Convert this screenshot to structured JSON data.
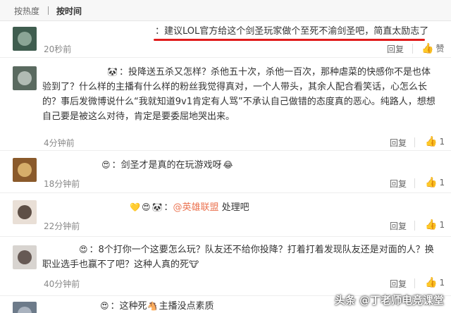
{
  "sort_bar": {
    "hot_label": "按热度",
    "time_label": "按时间"
  },
  "comments": [
    {
      "prefix": "：",
      "text": "建议LOL官方给这个剑圣玩家做个至死不渝剑圣吧，简直太励志了",
      "time": "20秒前",
      "reply_label": "回复",
      "like_label": "赞"
    },
    {
      "prefix": "：",
      "text": "投降送五杀又怎样？杀他五十次，杀他一百次，那种虐菜的快感你不是也体验到了？什么样的主播有什么样的粉丝我觉得真对，一个人带头，其余人配合看笑话，心怎么长的？事后发微博说什么“我就知道9v1肯定有人骂”不承认自己做错的态度真的恶心。纯路人，想想自己要是被这么对待，肯定是要委屈地哭出来。",
      "time": "4分钟前",
      "reply_label": "回复",
      "like_label": "1"
    },
    {
      "prefix": "：",
      "text": "剑圣才是真的在玩游戏呀",
      "time": "18分钟前",
      "reply_label": "回复",
      "like_label": "1"
    },
    {
      "prefix": "：",
      "mention": "@英雄联盟",
      "text": " 处理吧",
      "time": "22分钟前",
      "reply_label": "回复",
      "like_label": "1"
    },
    {
      "prefix": "：",
      "text": "8个打你一个这要怎么玩？队友还不给你投降？打着打着发现队友还是对面的人？换职业选手也赢不了吧？这种人真的死",
      "time": "40分钟前",
      "reply_label": "回复",
      "like_label": "1"
    },
    {
      "prefix": "：",
      "text": "这种死",
      "text2": "主播没点素质",
      "time": "",
      "reply_label": "",
      "like_label": ""
    }
  ],
  "watermark": "头条 @丁老师电竞课堂",
  "colors": {
    "highlight_underline": "#e01b1b",
    "mention": "#eb7350"
  }
}
